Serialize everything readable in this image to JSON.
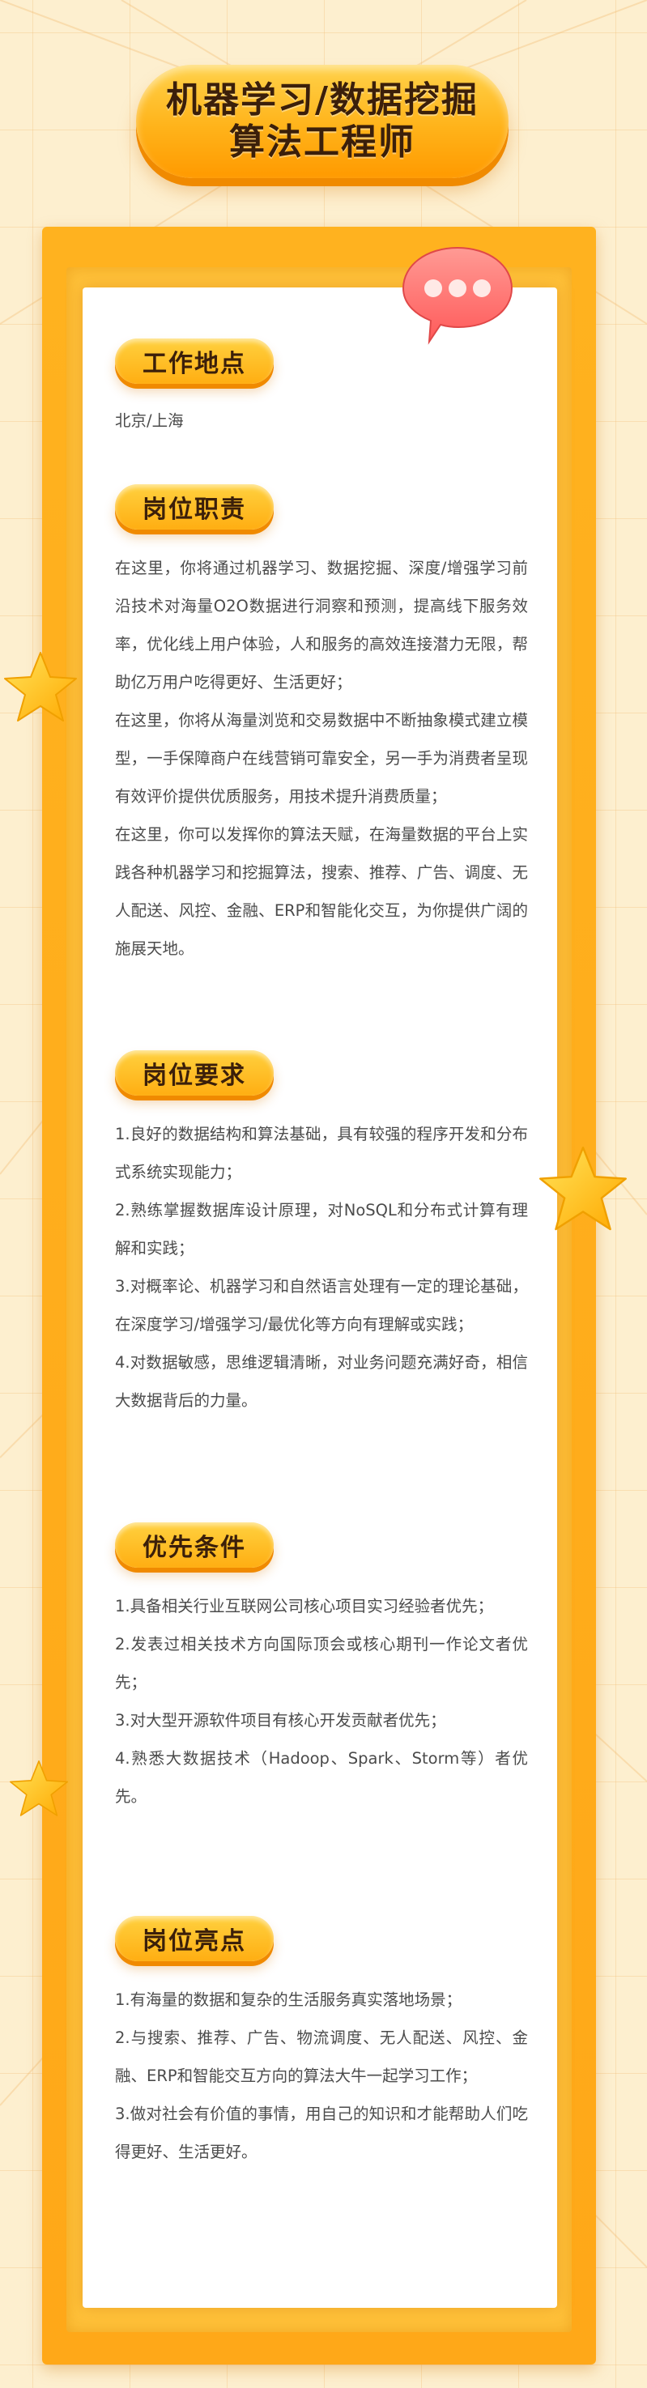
{
  "title": {
    "line1": "机器学习/数据挖掘",
    "line2": "算法工程师"
  },
  "sections": {
    "location": {
      "heading": "工作地点",
      "lines": [
        "北京/上海"
      ]
    },
    "duties": {
      "heading": "岗位职责",
      "lines": [
        "在这里，你将通过机器学习、数据挖掘、深度/增强学习前沿技术对海量O2O数据进行洞察和预测，提高线下服务效率，优化线上用户体验，人和服务的高效连接潜力无限，帮助亿万用户吃得更好、生活更好；",
        "在这里，你将从海量浏览和交易数据中不断抽象模式建立模型，一手保障商户在线营销可靠安全，另一手为消费者呈现有效评价提供优质服务，用技术提升消费质量；",
        "在这里，你可以发挥你的算法天赋，在海量数据的平台上实践各种机器学习和挖掘算法，搜索、推荐、广告、调度、无人配送、风控、金融、ERP和智能化交互，为你提供广阔的施展天地。"
      ]
    },
    "requirements": {
      "heading": "岗位要求",
      "lines": [
        "1.良好的数据结构和算法基础，具有较强的程序开发和分布式系统实现能力；",
        "2.熟练掌握数据库设计原理，对NoSQL和分布式计算有理解和实践；",
        "3.对概率论、机器学习和自然语言处理有一定的理论基础，在深度学习/增强学习/最优化等方向有理解或实践；",
        "4.对数据敏感，思维逻辑清晰，对业务问题充满好奇，相信大数据背后的力量。"
      ]
    },
    "preferred": {
      "heading": "优先条件",
      "lines": [
        "1.具备相关行业互联网公司核心项目实习经验者优先；",
        "2.发表过相关技术方向国际顶会或核心期刊一作论文者优先；",
        "3.对大型开源软件项目有核心开发贡献者优先；",
        "4.熟悉大数据技术（Hadoop、Spark、Storm等）者优先。"
      ]
    },
    "highlights": {
      "heading": "岗位亮点",
      "lines": [
        "1.有海量的数据和复杂的生活服务真实落地场景；",
        "2.与搜索、推荐、广告、物流调度、无人配送、风控、金融、ERP和智能交互方向的算法大牛一起学习工作；",
        "3.做对社会有价值的事情，用自己的知识和才能帮助人们吃得更好、生活更好。"
      ]
    }
  },
  "colors": {
    "background": "#fdefcf",
    "accent_orange": "#ffae12",
    "frame_orange": "#ffa818",
    "title_text": "#3b1f0a",
    "body_text": "#4b4b4b",
    "bubble_pink": "#ff6f6f"
  },
  "icons": [
    "chat-bubble-icon",
    "star-icon"
  ]
}
